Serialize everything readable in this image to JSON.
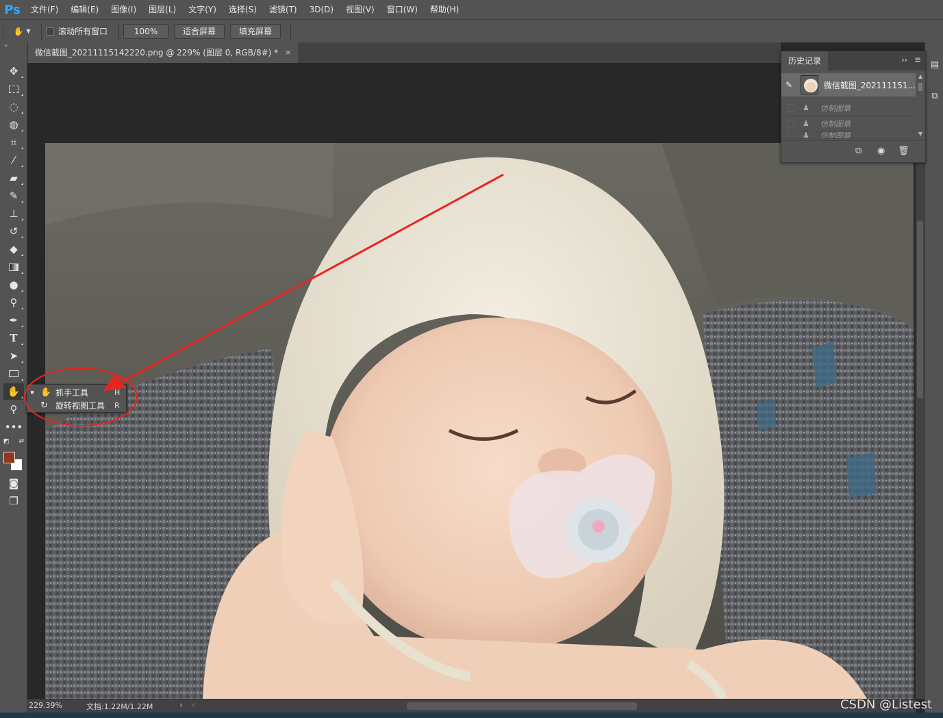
{
  "app": {
    "logo": "Ps"
  },
  "menu": [
    "文件(F)",
    "编辑(E)",
    "图像(I)",
    "图层(L)",
    "文字(Y)",
    "选择(S)",
    "滤镜(T)",
    "3D(D)",
    "视图(V)",
    "窗口(W)",
    "帮助(H)"
  ],
  "options": {
    "scroll_all": "滚动所有窗口",
    "zoom": "100%",
    "fit_screen": "适合屏幕",
    "fill_screen": "填充屏幕"
  },
  "document": {
    "tab_title": "微信截图_20211115142220.png @ 229% (图层 0, RGB/8#) *",
    "close": "×"
  },
  "history": {
    "title": "历史记录",
    "snapshot": "微信截图_202111151...",
    "steps": [
      "仿制图章",
      "仿制图章",
      "仿制图章"
    ]
  },
  "flyout": {
    "items": [
      {
        "label": "抓手工具",
        "key": "H",
        "icon": "hand-icon"
      },
      {
        "label": "旋转视图工具",
        "key": "R",
        "icon": "rotate-view-icon"
      }
    ]
  },
  "status": {
    "zoom": "229.39%",
    "doc": "文档:1.22M/1.22M",
    "arrow": "›",
    "scroll_left": "‹"
  },
  "watermark": "CSDN @Listest",
  "colors": {
    "foreground": "#8b3a22",
    "background": "#ffffff",
    "annotation": "#e8251f"
  }
}
